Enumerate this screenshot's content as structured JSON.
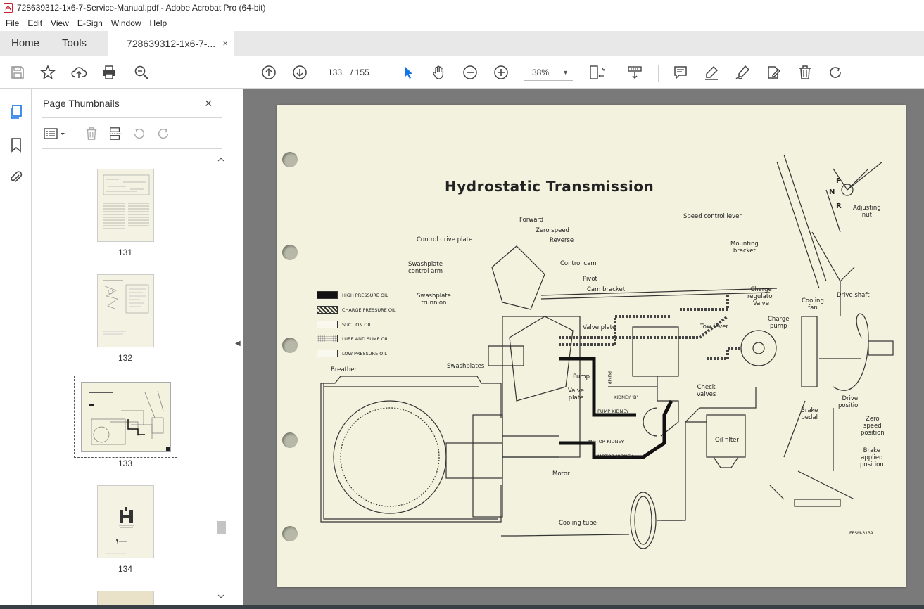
{
  "window": {
    "title": "728639312-1x6-7-Service-Manual.pdf - Adobe Acrobat Pro (64-bit)"
  },
  "menu": [
    "File",
    "Edit",
    "View",
    "E-Sign",
    "Window",
    "Help"
  ],
  "tabs": {
    "home": "Home",
    "tools": "Tools",
    "document": "728639312-1x6-7-...",
    "close": "×"
  },
  "toolbar": {
    "current_page": "133",
    "total_pages": "/ 155",
    "zoom": "38%"
  },
  "panel": {
    "title": "Page Thumbnails",
    "close": "×",
    "thumbnails": [
      {
        "label": "131"
      },
      {
        "label": "132"
      },
      {
        "label": "133",
        "selected": true
      },
      {
        "label": "134"
      }
    ]
  },
  "document": {
    "title": "Hydrostatic Transmission",
    "legend": [
      {
        "label": "HIGH PRESSURE OIL",
        "style": "solid-black"
      },
      {
        "label": "CHARGE PRESSURE OIL",
        "style": "hatched"
      },
      {
        "label": "SUCTION OIL",
        "style": "white"
      },
      {
        "label": "LUBE AND SUMP OIL",
        "style": "dotted"
      },
      {
        "label": "LOW PRESSURE OIL",
        "style": "white"
      }
    ],
    "labels": {
      "forward": "Forward",
      "zero_speed": "Zero speed",
      "reverse": "Reverse",
      "control_drive_plate": "Control drive plate",
      "swashplate_control_arm_1": "Swashplate",
      "swashplate_control_arm_2": "control arm",
      "control_cam": "Control cam",
      "pivot": "Pivot",
      "cam_bracket": "Cam bracket",
      "swashplate_trunnion_1": "Swashplate",
      "swashplate_trunnion_2": "trunnion",
      "speed_control_lever": "Speed control lever",
      "mounting_bracket_1": "Mounting",
      "mounting_bracket_2": "bracket",
      "f": "F",
      "n": "N",
      "r": "R",
      "adjusting_nut_1": "Adjusting",
      "adjusting_nut_2": "nut",
      "charge_regulator_1": "Charge",
      "charge_regulator_2": "regulator",
      "charge_regulator_3": "Valve",
      "cooling_fan_1": "Cooling",
      "cooling_fan_2": "fan",
      "drive_shaft": "Drive shaft",
      "charge_pump_1": "Charge",
      "charge_pump_2": "pump",
      "valve_plate_top": "Valve plate",
      "tow_lever": "Tow lever",
      "breather": "Breather",
      "swashplates": "Swashplates",
      "pump": "Pump",
      "valve_plate_1": "Valve",
      "valve_plate_2": "plate",
      "check_valves_1": "Check",
      "check_valves_2": "valves",
      "pump_kidney_a": "PUMP",
      "pump_kidney_b": "KIDNEY 'B'",
      "pump_kidney_main": "PUMP KIDNEY",
      "motor_kidney_main": "MOTOR KIDNEY",
      "motor_kidney_b": "MOTOR KIDNEY",
      "brake_pedal_1": "Brake",
      "brake_pedal_2": "pedal",
      "drive_position_1": "Drive",
      "drive_position_2": "position",
      "zero_speed_position_1": "Zero",
      "zero_speed_position_2": "speed",
      "zero_speed_position_3": "position",
      "brake_applied_1": "Brake",
      "brake_applied_2": "applied",
      "brake_applied_3": "position",
      "oil_filter": "Oil filter",
      "motor": "Motor",
      "cooling_tube": "Cooling tube",
      "figure_id": "FESM-3139"
    }
  }
}
